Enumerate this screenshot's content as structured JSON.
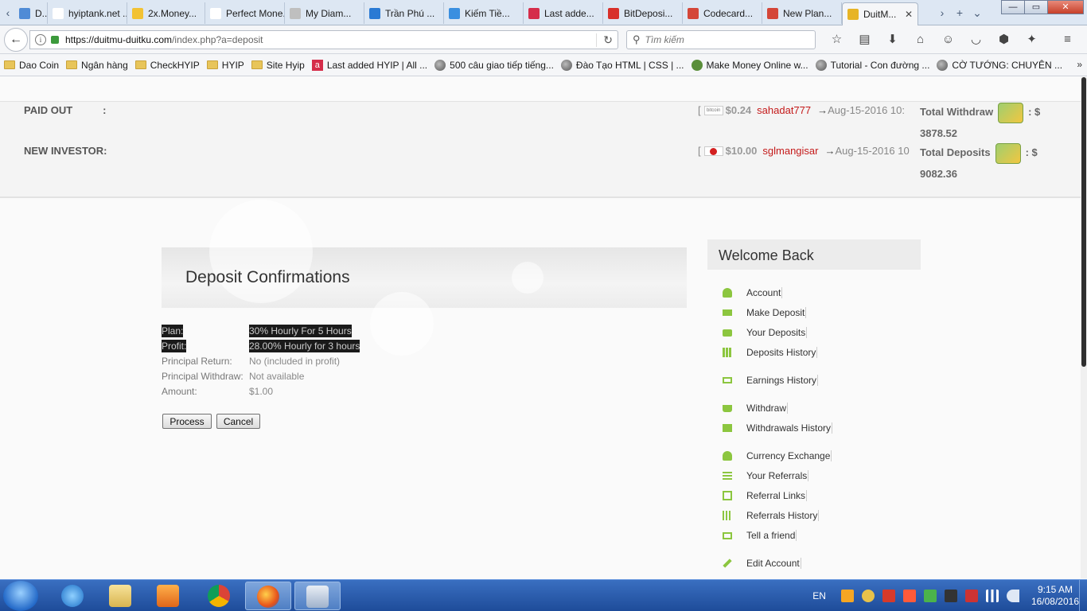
{
  "browser": {
    "tabs": [
      {
        "label": "D...",
        "favicon_color": "#4f8bd6"
      },
      {
        "label": "hyiptank.net ...",
        "favicon_color": "#ffffff"
      },
      {
        "label": "2x.Money...",
        "favicon_color": "#f2c233"
      },
      {
        "label": "Perfect Mone...",
        "favicon_color": "#ffffff"
      },
      {
        "label": "My Diam...",
        "favicon_color": "#bfbfbf"
      },
      {
        "label": "Trần Phú ...",
        "favicon_color": "#2a7ad4"
      },
      {
        "label": "Kiếm Tiề...",
        "favicon_color": "#3a8fe0"
      },
      {
        "label": "Last adde...",
        "favicon_color": "#d52d4a"
      },
      {
        "label": "BitDeposi...",
        "favicon_color": "#d8302a"
      },
      {
        "label": "Codecard...",
        "favicon_color": "#d44638"
      },
      {
        "label": "New Plan...",
        "favicon_color": "#d44638"
      },
      {
        "label": "DuitM...",
        "favicon_color": "#e7b425",
        "active": true
      }
    ],
    "tab_close_glyph": "✕",
    "new_tab_glyph": "+",
    "window_controls": {
      "minimize": "—",
      "maximize": "▭",
      "close": "✕"
    },
    "url_host": "https://duitmu-duitku.com",
    "url_path": "/index.php?a=deposit",
    "search_placeholder": "Tìm kiếm"
  },
  "bookmarks": [
    {
      "label": "Dao Coin",
      "icon": "folder-icon"
    },
    {
      "label": "Ngân hàng",
      "icon": "folder-icon"
    },
    {
      "label": "CheckHYIP",
      "icon": "folder-icon"
    },
    {
      "label": "HYIP",
      "icon": "folder-icon"
    },
    {
      "label": "Site Hyip",
      "icon": "folder-icon"
    },
    {
      "label": "Last added HYIP | All ...",
      "icon": "a-icon"
    },
    {
      "label": "500 câu giao tiếp tiếng...",
      "icon": "globe-icon"
    },
    {
      "label": "Đào Tạo HTML | CSS | ...",
      "icon": "globe-icon"
    },
    {
      "label": "Make Money Online w...",
      "icon": "frog-icon"
    },
    {
      "label": "Tutorial - Con đường ...",
      "icon": "globe-icon"
    },
    {
      "label": "CỜ TƯỚNG: CHUYÊN ...",
      "icon": "globe-icon"
    }
  ],
  "stats": {
    "paid_out_label": "PAID OUT",
    "colon": ":",
    "new_investor_label": "NEW INVESTOR:",
    "paid_out": {
      "bracket": "[",
      "badge": "bitcoin",
      "amount": "$0.24",
      "user": "sahadat777",
      "arrow": "→",
      "date": "Aug-15-2016 10:"
    },
    "new_investor": {
      "bracket": "[",
      "amount": "$10.00",
      "user": "sglmangisar",
      "arrow": "→",
      "date": "Aug-15-2016 10"
    },
    "total_withdraw_label": "Total Withdraw",
    "total_withdraw_suffix": ": $",
    "total_withdraw_value": "3878.52",
    "total_deposits_label": "Total Deposits",
    "total_deposits_suffix": ": $",
    "total_deposits_value": "9082.36"
  },
  "deposit": {
    "title": "Deposit Confirmations",
    "rows": [
      {
        "label": "Plan:",
        "value": "30% Hourly For 5 Hours"
      },
      {
        "label": "Profit:",
        "value": "28.00% Hourly for 3 hours"
      },
      {
        "label": "Principal Return:",
        "value": "No (included in profit)"
      },
      {
        "label": "Principal Withdraw:",
        "value": "Not available"
      },
      {
        "label": "Amount:",
        "value": "$1.00"
      }
    ],
    "process_label": "Process",
    "cancel_label": "Cancel"
  },
  "sidebar": {
    "title": "Welcome Back",
    "items": [
      {
        "label": "Account",
        "icon": "user-icon"
      },
      {
        "label": "Make Deposit",
        "icon": "credit-card-icon"
      },
      {
        "label": "Your Deposits",
        "icon": "wallet-icon"
      },
      {
        "label": "Deposits History",
        "icon": "table-icon"
      },
      {
        "label": "Earnings History",
        "icon": "money-icon"
      },
      {
        "label": "Withdraw",
        "icon": "cart-icon"
      },
      {
        "label": "Withdrawals History",
        "icon": "archive-icon"
      },
      {
        "label": "Currency Exchange",
        "icon": "user-icon"
      },
      {
        "label": "Your Referrals",
        "icon": "list-icon"
      },
      {
        "label": "Referral Links",
        "icon": "copy-icon"
      },
      {
        "label": "Referrals History",
        "icon": "bar-chart-icon"
      },
      {
        "label": "Tell a friend",
        "icon": "envelope-icon"
      },
      {
        "label": "Edit Account",
        "icon": "wrench-icon"
      }
    ],
    "icon_color": "#8cc63f"
  },
  "taskbar": {
    "language": "EN",
    "time": "9:15 AM",
    "date": "16/08/2016"
  }
}
